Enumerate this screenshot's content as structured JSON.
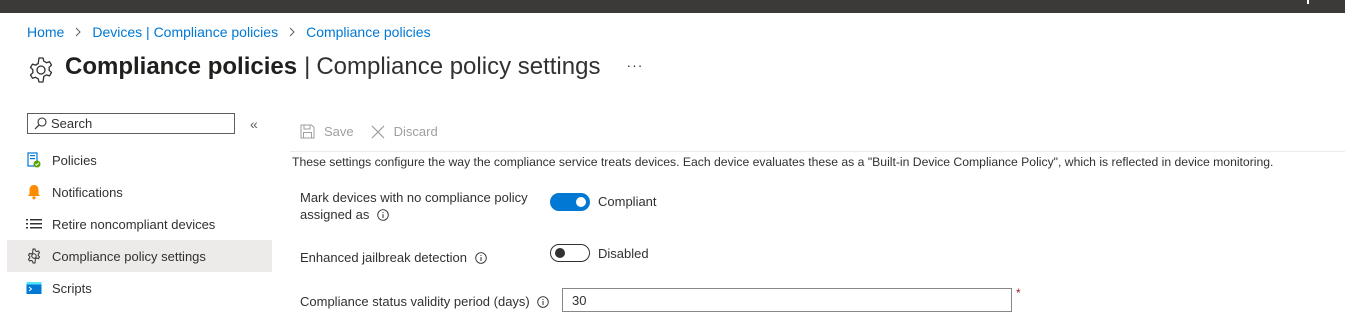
{
  "breadcrumb": {
    "items": [
      "Home",
      "Devices | Compliance policies",
      "Compliance policies"
    ]
  },
  "header": {
    "title_strong": "Compliance policies",
    "separator": "|",
    "title_sub": "Compliance policy settings",
    "more_label": "···",
    "icon": "gear-icon"
  },
  "sidebar": {
    "search_placeholder": "Search",
    "collapse_label": "«",
    "items": [
      {
        "label": "Policies",
        "icon": "policies-icon",
        "selected": false
      },
      {
        "label": "Notifications",
        "icon": "bell-icon",
        "selected": false
      },
      {
        "label": "Retire noncompliant devices",
        "icon": "list-icon",
        "selected": false
      },
      {
        "label": "Compliance policy settings",
        "icon": "gear-icon",
        "selected": true
      },
      {
        "label": "Scripts",
        "icon": "script-icon",
        "selected": false
      }
    ]
  },
  "toolbar": {
    "save_label": "Save",
    "discard_label": "Discard"
  },
  "main": {
    "description": "These settings configure the way the compliance service treats devices. Each device evaluates these as a \"Built-in Device Compliance Policy\", which is reflected in device monitoring.",
    "settings": {
      "mark_devices": {
        "label_line1": "Mark devices with no compliance policy",
        "label_line2": "assigned as",
        "value": "Compliant",
        "on": true
      },
      "jailbreak": {
        "label": "Enhanced jailbreak detection",
        "value": "Disabled",
        "on": false
      },
      "validity": {
        "label": "Compliance status validity period (days)",
        "value": "30",
        "required_mark": "*"
      }
    }
  },
  "colors": {
    "accent": "#0078d4",
    "selected_bg": "#edebe9",
    "topbar": "#3b3a39",
    "required": "#a4262c"
  }
}
